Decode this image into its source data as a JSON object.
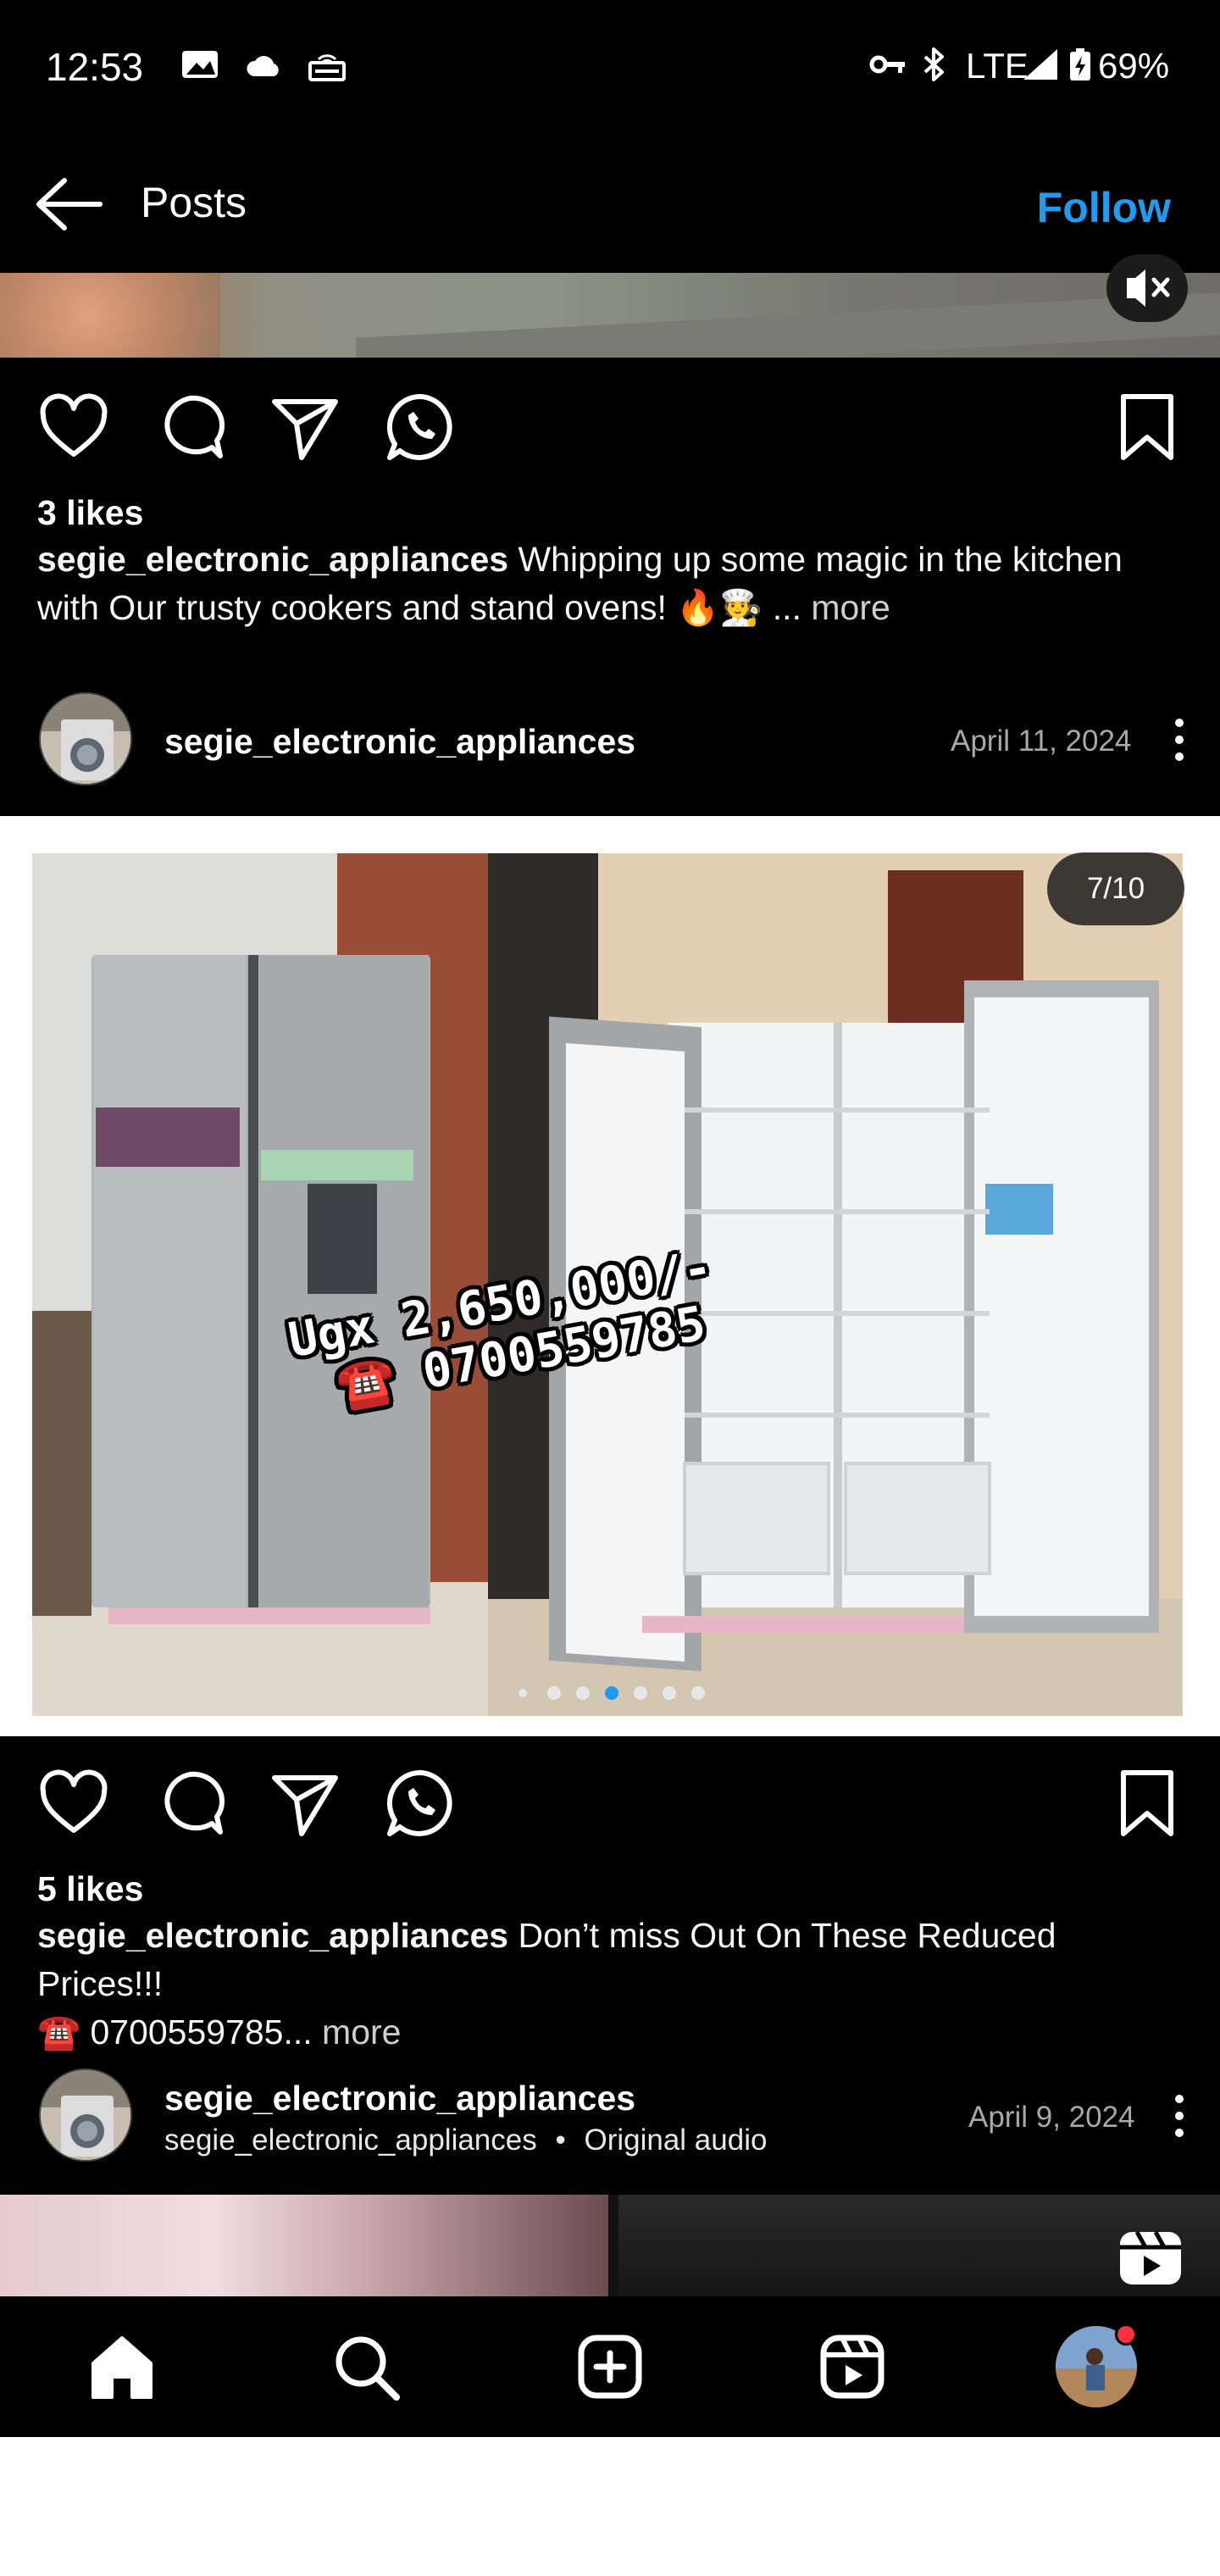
{
  "status_bar": {
    "time": "12:53",
    "network": "LTE",
    "battery": "69%",
    "icons": [
      "gallery-icon",
      "cloud-icon",
      "hotspot-icon",
      "vpn-key-icon",
      "bluetooth-icon",
      "signal-icon",
      "battery-icon"
    ]
  },
  "header": {
    "title": "Posts",
    "follow_label": "Follow"
  },
  "post1": {
    "likes": "3 likes",
    "caption_user": "segie_electronic_appliances",
    "caption_line1": "Whipping up some magic in the kitchen",
    "caption_line2": "with Our trusty cookers and stand ovens! 🔥🧑‍🍳 ...",
    "more": "more"
  },
  "post2": {
    "username": "segie_electronic_appliances",
    "date": "April 11, 2024",
    "counter": "7/10",
    "image_overlay": {
      "price": "Ugx 2,650,000/-",
      "phone": "☎️ 0700559785"
    },
    "dots_total": 7,
    "dots_active_index": 3,
    "likes": "5 likes",
    "caption_user": "segie_electronic_appliances",
    "caption_line1": "Don’t miss Out On These Reduced Prices!!!",
    "caption_line2": "☎️ 0700559785...",
    "more": "more"
  },
  "post3": {
    "username": "segie_electronic_appliances",
    "sub_user": "segie_electronic_appliances",
    "separator": "•",
    "audio": "Original audio",
    "date": "April 9, 2024"
  },
  "bottom_nav": {
    "items": [
      "home-icon",
      "search-icon",
      "create-icon",
      "reels-icon",
      "profile-avatar"
    ]
  },
  "colors": {
    "accent": "#1f9bf0",
    "background": "#000000",
    "notification": "#ff3040"
  }
}
